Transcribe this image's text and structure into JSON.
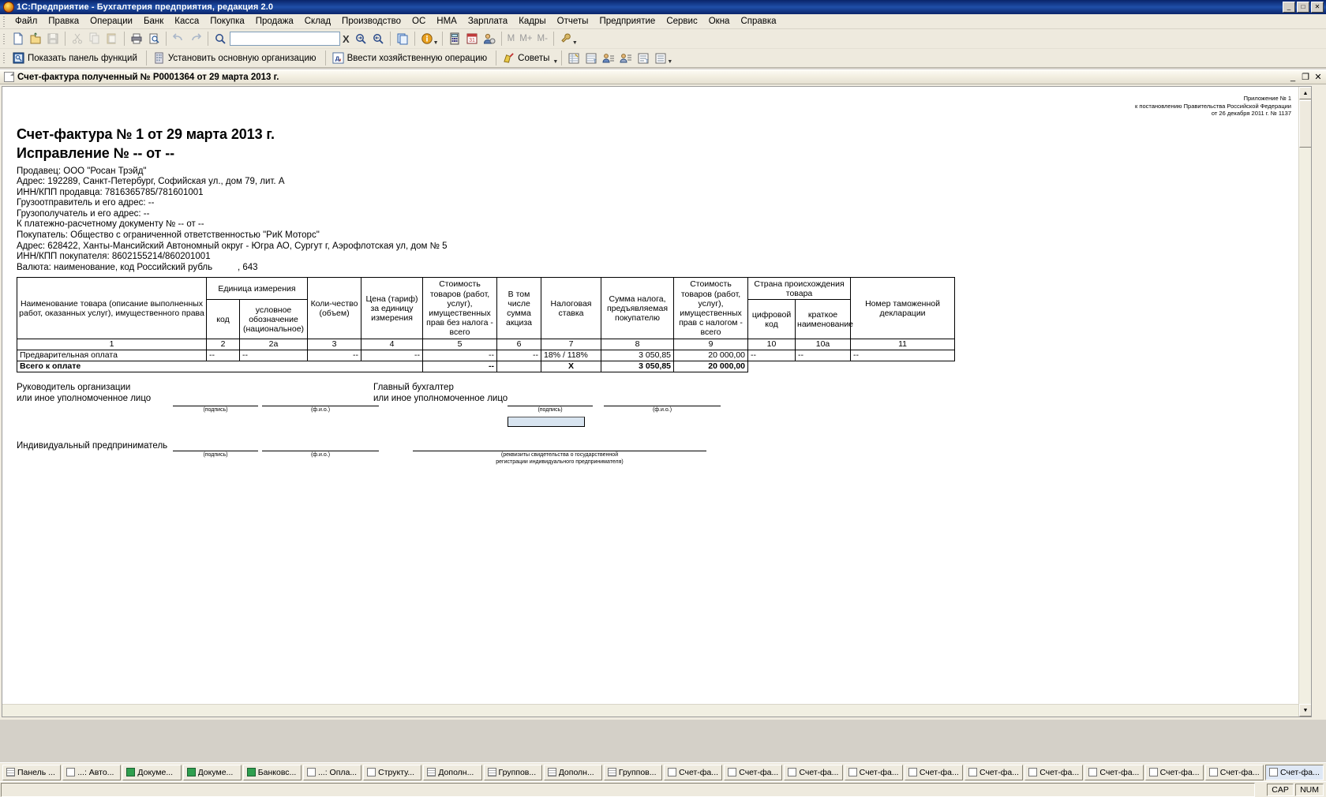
{
  "app": {
    "title": "1С:Предприятие - Бухгалтерия предприятия, редакция 2.0",
    "icon": "1c-logo-icon",
    "minimize": "_",
    "maximize": "□",
    "close": "✕"
  },
  "menubar": [
    "Файл",
    "Правка",
    "Операции",
    "Банк",
    "Касса",
    "Покупка",
    "Продажа",
    "Склад",
    "Производство",
    "ОС",
    "НМА",
    "Зарплата",
    "Кадры",
    "Отчеты",
    "Предприятие",
    "Сервис",
    "Окна",
    "Справка"
  ],
  "toolbar1": {
    "search_value": "",
    "letters": [
      "M",
      "M+",
      "M-"
    ],
    "close_search_label": "X"
  },
  "toolbar2": {
    "buttons": [
      "Показать панель функций",
      "Установить основную организацию",
      "Ввести хозяйственную операцию",
      "Советы"
    ]
  },
  "document_window": {
    "title": "Счет-фактура полученный № Р0001364 от 29 марта 2013 г.",
    "minimize": "_",
    "restore": "❐",
    "close": "✕"
  },
  "report": {
    "legal_header": [
      "Приложение № 1",
      "к постановлению Правительства Российской Федерации",
      "от 26 декабря 2011 г. № 1137"
    ],
    "title": "Счет-фактура № 1 от 29 марта 2013 г.",
    "subtitle": "Исправление № -- от --",
    "info_lines": [
      "Продавец: ООО \"Росан Трэйд\"",
      "Адрес: 192289, Санкт-Петербург, Софийская ул., дом 79, лит. А",
      "ИНН/КПП продавца: 7816365785/781601001",
      "Грузоотправитель и его адрес: --",
      "Грузополучатель и его адрес: --",
      "К платежно-расчетному документу № -- от --",
      "Покупатель: Общество с ограниченной ответственностью  \"РиК Моторс\"",
      "Адрес: 628422, Ханты-Мансийский Автономный округ - Югра АО, Сургут г, Аэрофлотская ул, дом № 5",
      "ИНН/КПП покупателя: 8602155214/860201001"
    ],
    "currency_label": "Валюта: наименование, код Российский рубль",
    "currency_code": ", 643",
    "table": {
      "headers": {
        "name": "Наименование товара (описание выполненных работ, оказанных услуг), имущественного права",
        "unit_group": "Единица измерения",
        "unit_code": "код",
        "unit_symbol": "условное обозначение (национальное)",
        "quantity": "Коли-чество (объем)",
        "price": "Цена (тариф) за единицу измерения",
        "cost_no_tax": "Стоимость товаров (работ, услуг), имущественных прав без налога - всего",
        "excise": "В том числе сумма акциза",
        "tax_rate": "Налоговая ставка",
        "tax_sum": "Сумма налога, предъявляемая покупателю",
        "cost_with_tax": "Стоимость товаров (работ, услуг), имущественных прав с налогом - всего",
        "country_group": "Страна происхождения товара",
        "country_code": "цифровой код",
        "country_name": "краткое наименование",
        "customs_decl": "Номер таможенной декларации"
      },
      "column_numbers": [
        "1",
        "2",
        "2а",
        "3",
        "4",
        "5",
        "6",
        "7",
        "8",
        "9",
        "10",
        "10а",
        "11"
      ],
      "rows": [
        {
          "name": "Предварительная оплата",
          "unit_code": "--",
          "unit_symbol": "--",
          "quantity": "--",
          "price": "--",
          "cost_no_tax": "--",
          "excise": "--",
          "tax_rate": "18% / 118%",
          "tax_sum": "3 050,85",
          "cost_with_tax": "20 000,00",
          "country_code": "--",
          "country_name": "--",
          "customs_decl": "--"
        }
      ],
      "total": {
        "label": "Всего к оплате",
        "cost_no_tax": "--",
        "excise": "",
        "tax_rate": "X",
        "tax_sum": "3 050,85",
        "cost_with_tax": "20 000,00"
      }
    },
    "signatures": {
      "director_line1": "Руководитель организации",
      "director_line2": "или иное уполномоченное лицо",
      "accountant_line1": "Главный бухгалтер",
      "accountant_line2": "или иное уполномоченное лицо",
      "entrepreneur": "Индивидуальный предприниматель",
      "caption_sign": "(подпись)",
      "caption_fio": "(ф.и.о.)",
      "registration_note": "(реквизиты свидетельства о государственной\nрегистрации индивидуального предпринимателя)"
    }
  },
  "taskbar": {
    "items": [
      {
        "label": "Панель ...",
        "icon": "grid-icon"
      },
      {
        "label": "...: Авто...",
        "icon": "doc-icon"
      },
      {
        "label": "Докуме...",
        "icon": "green-icon"
      },
      {
        "label": "Докуме...",
        "icon": "green-icon"
      },
      {
        "label": "Банковс...",
        "icon": "green-icon"
      },
      {
        "label": "...: Опла...",
        "icon": "doc-icon"
      },
      {
        "label": "Структу...",
        "icon": "doc-icon"
      },
      {
        "label": "Дополн...",
        "icon": "grid-icon"
      },
      {
        "label": "Группов...",
        "icon": "grid-icon"
      },
      {
        "label": "Дополн...",
        "icon": "grid-icon"
      },
      {
        "label": "Группов...",
        "icon": "grid-icon"
      },
      {
        "label": "Счет-фа...",
        "icon": "doc-icon"
      },
      {
        "label": "Счет-фа...",
        "icon": "doc-icon"
      },
      {
        "label": "Счет-фа...",
        "icon": "doc-icon"
      },
      {
        "label": "Счет-фа...",
        "icon": "doc-icon"
      },
      {
        "label": "Счет-фа...",
        "icon": "doc-icon"
      },
      {
        "label": "Счет-фа...",
        "icon": "doc-icon"
      },
      {
        "label": "Счет-фа...",
        "icon": "doc-icon"
      },
      {
        "label": "Счет-фа...",
        "icon": "doc-icon"
      },
      {
        "label": "Счет-фа...",
        "icon": "doc-icon"
      },
      {
        "label": "Счет-фа...",
        "icon": "doc-icon"
      },
      {
        "label": "Счет-фа...",
        "icon": "doc-icon",
        "active": true
      }
    ]
  },
  "statusbar": {
    "caps": "CAP",
    "num": "NUM"
  },
  "colors": {
    "titlebar": "#0a246a",
    "chrome": "#eeeade",
    "paper": "#ffffff",
    "field_highlight": "#d8e4f0"
  }
}
